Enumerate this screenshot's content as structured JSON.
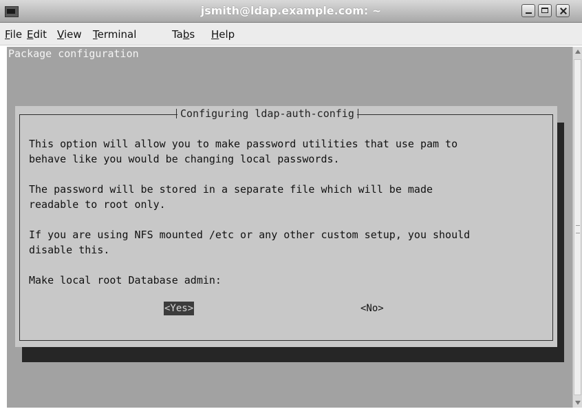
{
  "window": {
    "title": "jsmith@ldap.example.com: ~"
  },
  "menubar": {
    "items": [
      "File",
      "Edit",
      "View",
      "Terminal",
      "Tabs",
      "Help"
    ]
  },
  "terminal": {
    "screen_title": "Package configuration",
    "dialog": {
      "title": "Configuring ldap-auth-config",
      "lines": [
        "This option will allow you to make password utilities that use pam to",
        "behave like you would be changing local passwords.",
        "The password will be stored in a separate file which will be made",
        "readable to root only.",
        "If you are using NFS mounted /etc or any other custom setup, you should",
        "disable this.",
        "Make local root Database admin:"
      ],
      "yes_label": "<Yes>",
      "no_label": "<No>"
    }
  },
  "colors": {
    "terminal_bg": "#a2a2a2",
    "dialog_bg": "#c8c8c8",
    "shadow": "#262626",
    "selected_button_bg": "#3c3c3c"
  },
  "icons": [
    "terminal-icon",
    "minimize-icon",
    "maximize-icon",
    "close-icon",
    "scroll-up-icon",
    "scroll-down-icon"
  ]
}
